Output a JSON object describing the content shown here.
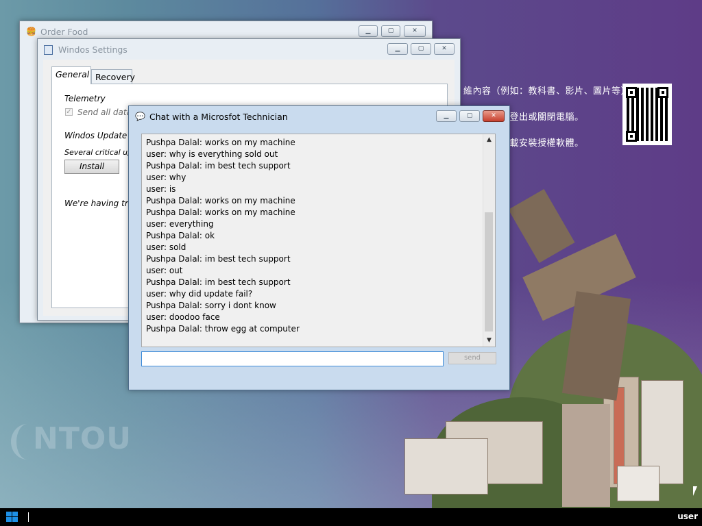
{
  "desktop": {
    "bg_lines": [
      "維內容（例如：教科書、影片、圖片等）。",
      "離開座位請登出或關閉電腦。",
      "軟體網站下載安裝授權軟體。"
    ],
    "logo_text": "NTOU"
  },
  "windows": {
    "order_food": {
      "title": "Order Food",
      "icon": "burger-icon"
    },
    "settings": {
      "title": "Windos Settings",
      "icon": "settings-app-icon",
      "tabs": [
        "General",
        "Recovery"
      ],
      "active_tab": "General",
      "telemetry_heading": "Telemetry",
      "send_data_label": "Send all data",
      "send_data_checked": true,
      "update_heading": "Windos Update",
      "update_text": "Several critical upd",
      "install_label": "Install",
      "trouble_text": "We're having tro"
    },
    "chat": {
      "title": "Chat with a Microsfot Technician",
      "icon": "chat-app-icon",
      "messages": [
        "Pushpa Dalal: works on my machine",
        "user: why is everything sold out",
        "Pushpa Dalal: im best tech support",
        "user: why",
        "user: is",
        "Pushpa Dalal: works on my machine",
        "Pushpa Dalal: works on my machine",
        "user: everything",
        "Pushpa Dalal: ok",
        "user: sold",
        "Pushpa Dalal: im best tech support",
        "user: out",
        "Pushpa Dalal: im best tech support",
        "user: why did update fail?",
        "Pushpa Dalal: sorry i dont know",
        "user: doodoo face",
        "Pushpa Dalal: throw egg at computer"
      ],
      "input_value": "",
      "send_label": "send"
    }
  },
  "title_buttons": {
    "minimize": "▁",
    "maximize": "▢",
    "close": "✕"
  },
  "taskbar": {
    "start_icon": "windows-logo-icon",
    "user_label": "user"
  },
  "colors": {
    "accent": "#3c8ad8",
    "close_button": "#c7402e",
    "taskbar": "#000000"
  }
}
